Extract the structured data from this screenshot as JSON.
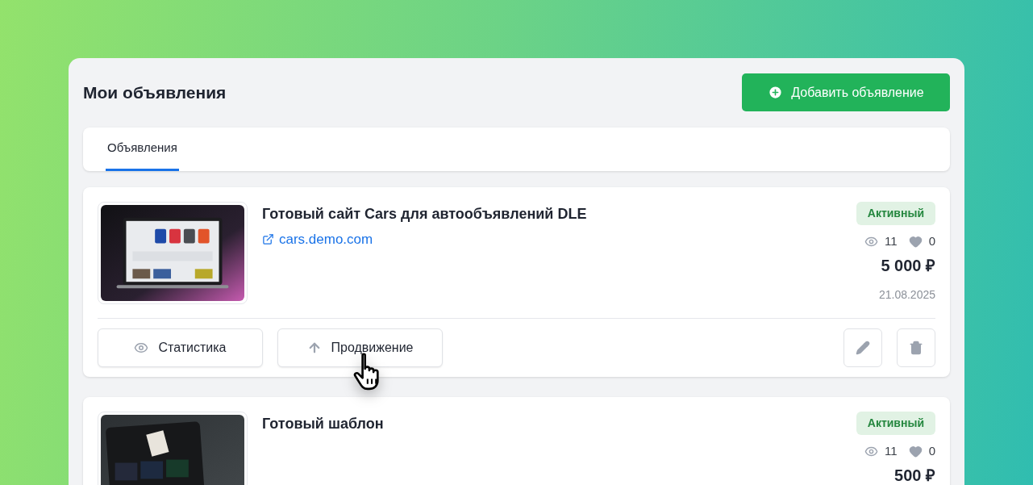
{
  "page": {
    "title": "Мои объявления",
    "add_button": "Добавить объявление"
  },
  "tabs": [
    {
      "label": "Объявления",
      "selected": true
    }
  ],
  "listings": [
    {
      "title": "Готовый сайт Cars для автообъявлений DLE",
      "link": "cars.demo.com",
      "status": "Активный",
      "views": "11",
      "likes": "0",
      "price": "5 000 ₽",
      "date": "21.08.2025",
      "actions": [
        "Статистика",
        "Продвижение"
      ]
    },
    {
      "title": "Готовый шаблон",
      "status": "Активный",
      "views": "11",
      "likes": "0",
      "price": "500 ₽"
    }
  ]
}
